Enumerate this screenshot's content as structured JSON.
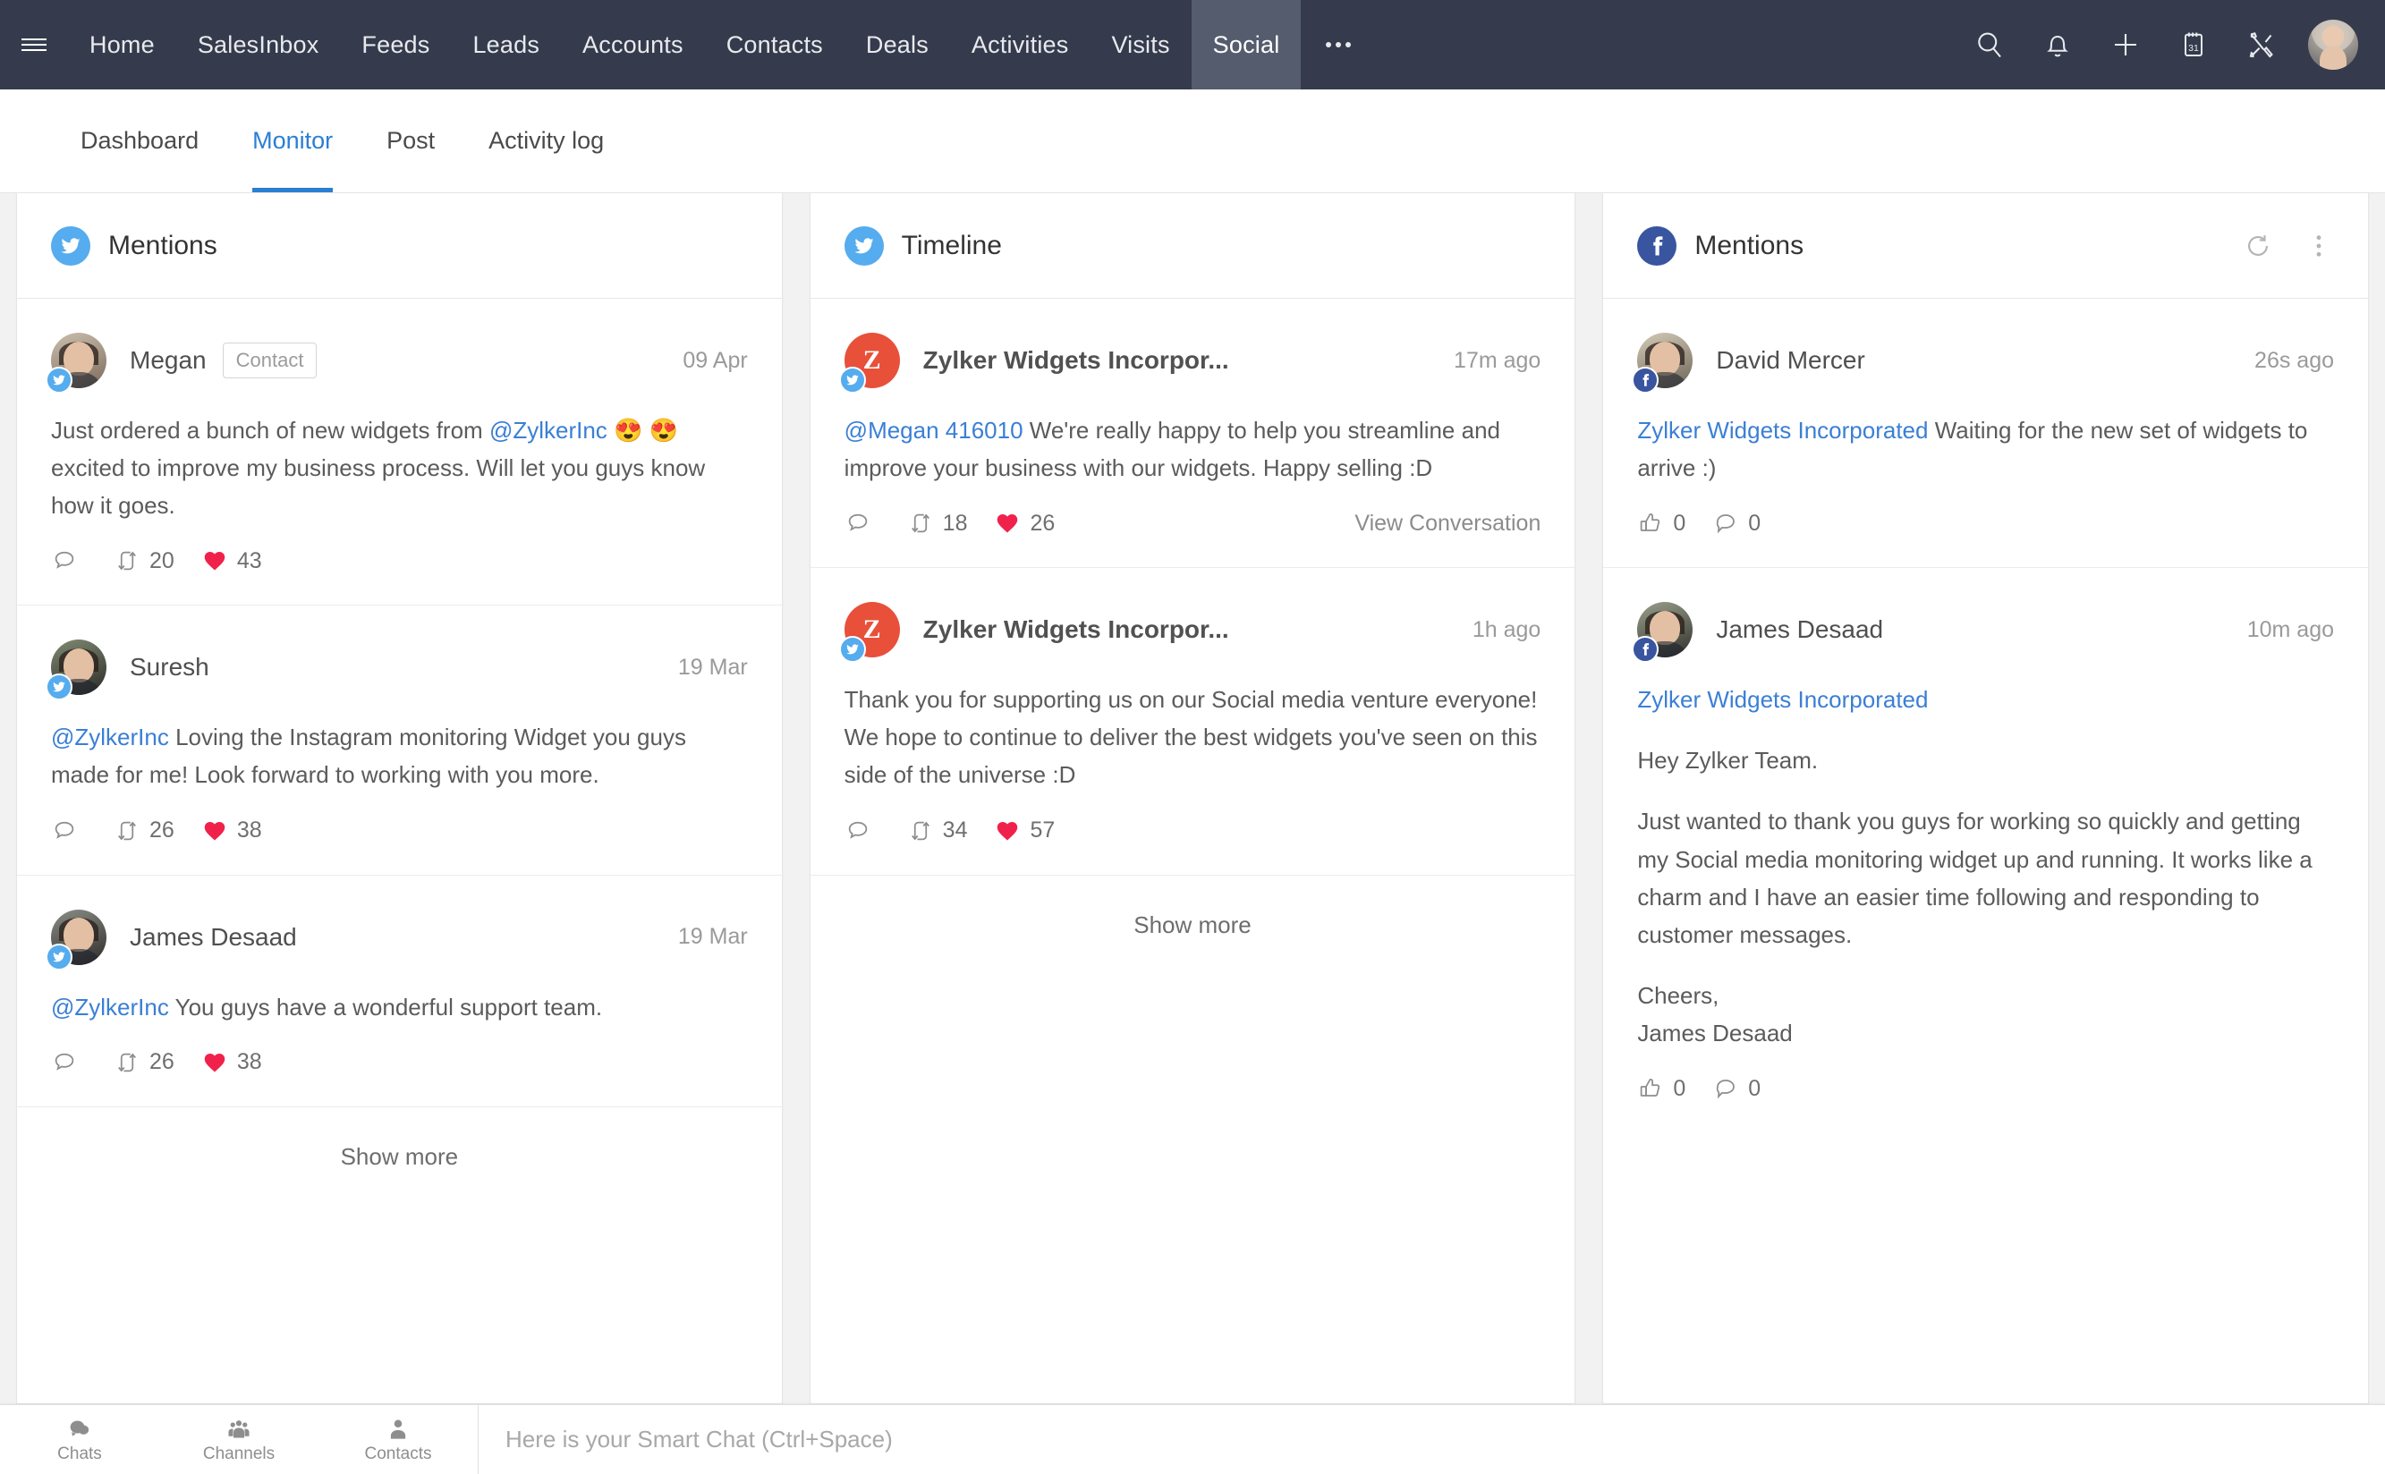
{
  "topnav": {
    "menu_icon": "hamburger-icon",
    "items": [
      {
        "label": "Home",
        "active": false
      },
      {
        "label": "SalesInbox",
        "active": false
      },
      {
        "label": "Feeds",
        "active": false
      },
      {
        "label": "Leads",
        "active": false
      },
      {
        "label": "Accounts",
        "active": false
      },
      {
        "label": "Contacts",
        "active": false
      },
      {
        "label": "Deals",
        "active": false
      },
      {
        "label": "Activities",
        "active": false
      },
      {
        "label": "Visits",
        "active": false
      },
      {
        "label": "Social",
        "active": true
      }
    ],
    "more_label": "...",
    "right_icons": [
      "search-icon",
      "notification-bell-icon",
      "add-icon",
      "calendar-icon",
      "tools-icon"
    ],
    "calendar_day": "31",
    "active_bg": "#555c6e",
    "bar_bg": "#353b4d"
  },
  "subtabs": {
    "items": [
      {
        "label": "Dashboard",
        "active": false
      },
      {
        "label": "Monitor",
        "active": true
      },
      {
        "label": "Post",
        "active": false
      },
      {
        "label": "Activity log",
        "active": false
      }
    ],
    "accent": "#2a7fd4"
  },
  "columns": [
    {
      "network": "twitter",
      "title": "Mentions",
      "show_more": "Show more",
      "has_header_actions": false,
      "posts": [
        {
          "author": "Megan",
          "tag": "Contact",
          "time": "09 Apr",
          "text_html": "Just ordered a bunch of new widgets from <span class=\"mention\">@ZylkerInc</span> <span class=\"emoji\">😍</span> <span class=\"emoji\">😍</span> excited to improve my business process. Will let you guys know how it goes.",
          "comments": "",
          "retweets": "20",
          "likes": "43",
          "avatar_class": "ph1"
        },
        {
          "author": "Suresh",
          "tag": "",
          "time": "19 Mar",
          "text_html": "<span class=\"mention\">@ZylkerInc</span> Loving the Instagram monitoring Widget you guys made for me! Look forward to working with you more.",
          "comments": "",
          "retweets": "26",
          "likes": "38",
          "avatar_class": "ph2"
        },
        {
          "author": "James Desaad",
          "tag": "",
          "time": "19 Mar",
          "text_html": "<span class=\"mention\">@ZylkerInc</span> You guys have a wonderful support team.",
          "comments": "",
          "retweets": "26",
          "likes": "38",
          "avatar_class": "ph3"
        }
      ]
    },
    {
      "network": "twitter",
      "title": "Timeline",
      "show_more": "Show more",
      "has_header_actions": false,
      "posts": [
        {
          "author": "Zylker Widgets Incorpor...",
          "tag": "",
          "time": "17m ago",
          "text_html": "<span class=\"mention\">@Megan 416010</span> We're really happy to help you streamline and improve your business with our widgets. Happy selling :D",
          "comments": "",
          "retweets": "18",
          "likes": "26",
          "view_conversation": "View Conversation",
          "avatar_class": "zy",
          "avatar_letter": "Z"
        },
        {
          "author": "Zylker Widgets Incorpor...",
          "tag": "",
          "time": "1h ago",
          "text_html": "Thank you for supporting us on our Social media venture everyone! We hope to continue to deliver the best widgets you've seen on this side of the universe :D",
          "comments": "",
          "retweets": "34",
          "likes": "57",
          "avatar_class": "zy",
          "avatar_letter": "Z"
        }
      ]
    },
    {
      "network": "facebook",
      "title": "Mentions",
      "show_more": "",
      "has_header_actions": true,
      "header_actions": [
        "refresh-icon",
        "more-vertical-icon"
      ],
      "posts": [
        {
          "author": "David Mercer",
          "tag": "",
          "time": "26s ago",
          "text_html": "<span class=\"fb-link\">Zylker Widgets Incorporated</span> Waiting for the new set of widgets to arrive :)",
          "likes": "0",
          "comments": "0",
          "avatar_class": "ph4"
        },
        {
          "author": "James Desaad",
          "tag": "",
          "time": "10m ago",
          "text_html": "<p><span class=\"fb-link\">Zylker Widgets Incorporated</span></p><p>Hey Zylker Team.</p><p>Just wanted to thank you guys for working so quickly and getting my Social media monitoring widget up and running. It works like a charm and I have an easier time following and responding to customer messages.</p><p>Cheers,<br>James Desaad</p>",
          "likes": "0",
          "comments": "0",
          "avatar_class": "ph5"
        }
      ]
    }
  ],
  "bottombar": {
    "buttons": [
      {
        "label": "Chats",
        "icon": "chat-bubbles-icon"
      },
      {
        "label": "Channels",
        "icon": "channels-group-icon"
      },
      {
        "label": "Contacts",
        "icon": "contact-person-icon"
      }
    ],
    "chat_placeholder": "Here is your Smart Chat (Ctrl+Space)"
  }
}
